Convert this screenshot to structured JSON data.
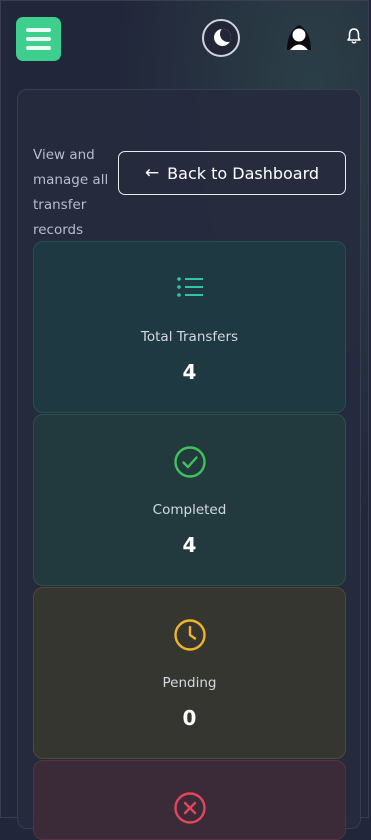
{
  "topbar": {
    "menu_icon": "hamburger-menu-icon",
    "theme_icon": "moon-icon",
    "avatar_icon": "user-avatar-icon",
    "bell_icon": "bell-icon"
  },
  "header": {
    "subtitle": "View and manage all transfer records",
    "back_button": "Back to Dashboard",
    "back_icon": "arrow-left-icon"
  },
  "stats": [
    {
      "label": "Total Transfers",
      "value": "4",
      "icon": "list-icon",
      "color": "#2ec6a8"
    },
    {
      "label": "Completed",
      "value": "4",
      "icon": "check-circle-icon",
      "color": "#3fc25a"
    },
    {
      "label": "Pending",
      "value": "0",
      "icon": "clock-icon",
      "color": "#f0b429"
    },
    {
      "label": "",
      "value": "",
      "icon": "x-circle-icon",
      "color": "#e0475a"
    }
  ],
  "colors": {
    "accent": "#3ecf8e",
    "background": "#22263a"
  }
}
